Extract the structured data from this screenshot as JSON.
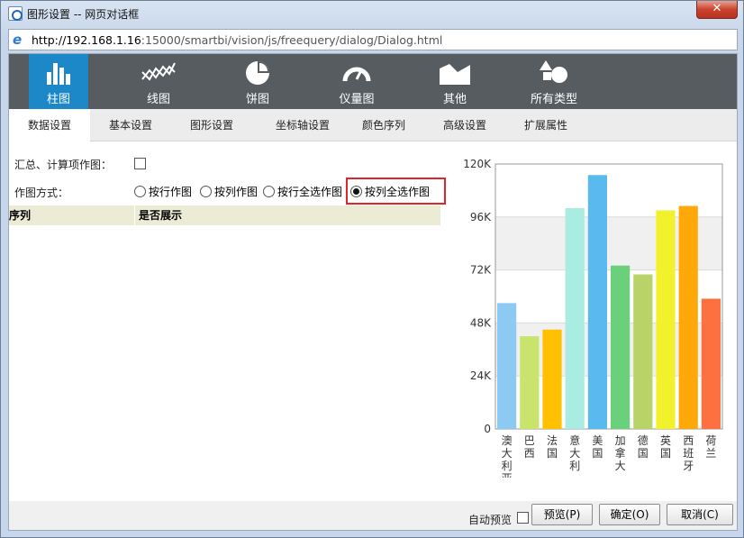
{
  "window": {
    "title": "图形设置 -- 网页对话框",
    "close_label": "✕",
    "address_host": "http://192.168.1.16",
    "address_rest": ":15000/smartbi/vision/js/freequery/dialog/Dialog.html"
  },
  "chart_types": [
    {
      "label": "柱图",
      "icon": "bar-chart-icon",
      "active": true
    },
    {
      "label": "线图",
      "icon": "line-chart-icon",
      "active": false
    },
    {
      "label": "饼图",
      "icon": "pie-chart-icon",
      "active": false
    },
    {
      "label": "仪量图",
      "icon": "gauge-icon",
      "active": false
    },
    {
      "label": "其他",
      "icon": "area-chart-icon",
      "active": false
    },
    {
      "label": "所有类型",
      "icon": "all-types-icon",
      "active": false
    }
  ],
  "tabs": [
    "数据设置",
    "基本设置",
    "图形设置",
    "坐标轴设置",
    "颜色序列",
    "高级设置",
    "扩展属性"
  ],
  "active_tab": "数据设置",
  "form": {
    "summary_label": "汇总、计算项作图：",
    "summary_checked": false,
    "mode_label": "作图方式：",
    "modes": [
      {
        "label": "按行作图",
        "selected": false
      },
      {
        "label": "按列作图",
        "selected": false
      },
      {
        "label": "按行全选作图",
        "selected": false
      },
      {
        "label": "按列全选作图",
        "selected": true
      }
    ]
  },
  "grid": {
    "columns": [
      "序列",
      "是否展示"
    ]
  },
  "chart_data": {
    "type": "bar",
    "categories": [
      "澳大利亚",
      "巴西",
      "法国",
      "意大利",
      "美国",
      "加拿大",
      "德国",
      "英国",
      "西班牙",
      "荷兰"
    ],
    "values": [
      57000,
      42000,
      45000,
      100000,
      115000,
      74000,
      70000,
      99000,
      101000,
      59000
    ],
    "colors": [
      "#8ccaf4",
      "#c8e46c",
      "#ffc000",
      "#a8ece2",
      "#5abaf0",
      "#6ad07c",
      "#b8d468",
      "#f2f22c",
      "#ffa80a",
      "#ff7040"
    ],
    "yticks": [
      "0",
      "24K",
      "48K",
      "72K",
      "96K",
      "120K"
    ],
    "ylim": [
      0,
      120000
    ],
    "title": "",
    "xlabel": "",
    "ylabel": ""
  },
  "footer": {
    "auto_preview_label": "自动预览",
    "auto_preview_checked": false,
    "preview_button": "预览(P)",
    "ok_button": "确定(O)",
    "cancel_button": "取消(C)"
  }
}
